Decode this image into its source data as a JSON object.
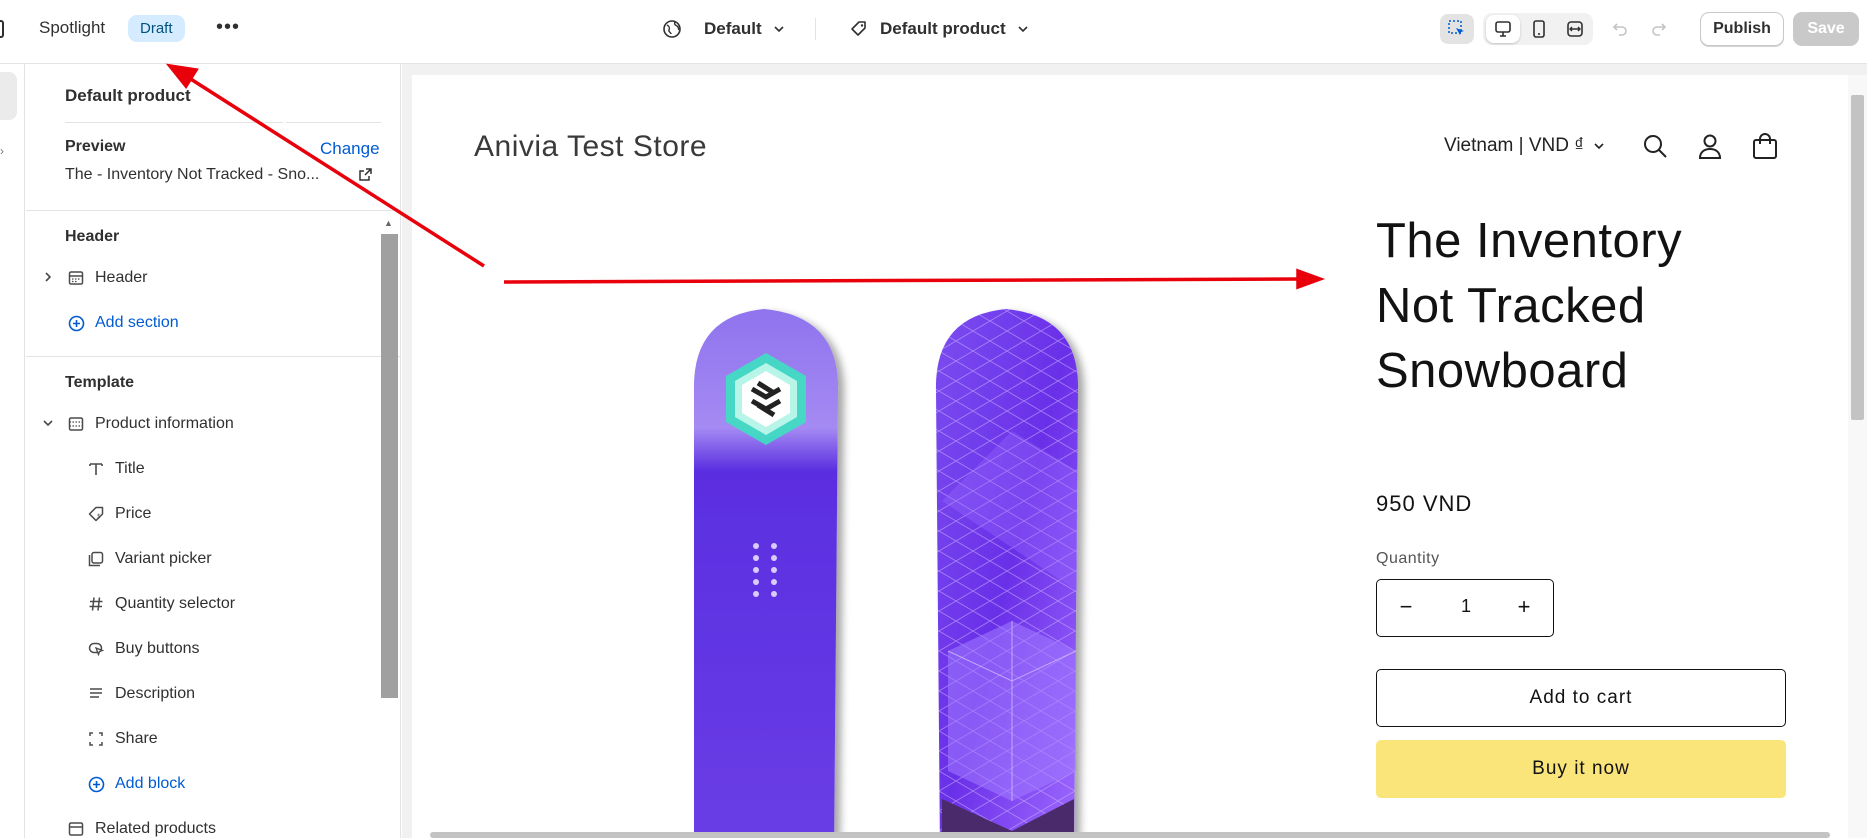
{
  "topbar": {
    "title": "Spotlight",
    "status_badge": "Draft",
    "more_icon": "more-horizontal-icon",
    "theme_selector": "Default",
    "template_selector": "Default product",
    "publish_label": "Publish",
    "save_label": "Save"
  },
  "sidebar": {
    "context_title": "Default product",
    "preview_label": "Preview",
    "change_label": "Change",
    "preview_value": "The - Inventory Not Tracked - Sno...",
    "header_group": "Header",
    "header_item": "Header",
    "add_section": "Add section",
    "template_group": "Template",
    "section": "Product information",
    "blocks": [
      {
        "label": "Title",
        "icon": "text-icon"
      },
      {
        "label": "Price",
        "icon": "price-tag-icon"
      },
      {
        "label": "Variant picker",
        "icon": "variant-icon"
      },
      {
        "label": "Quantity selector",
        "icon": "hash-icon"
      },
      {
        "label": "Buy buttons",
        "icon": "cursor-click-icon"
      },
      {
        "label": "Description",
        "icon": "text-lines-icon"
      },
      {
        "label": "Share",
        "icon": "share-frame-icon"
      }
    ],
    "add_block": "Add block",
    "related": "Related products"
  },
  "preview": {
    "store_name": "Anivia Test Store",
    "locale": "Vietnam | VND ₫",
    "product_title": "The Inventory Not Tracked Snowboard",
    "price": "950 VND",
    "quantity_label": "Quantity",
    "quantity_value": "1",
    "add_to_cart": "Add to cart",
    "buy_now": "Buy it now"
  },
  "colors": {
    "accent_link": "#005bd3",
    "badge_bg": "#d5ebff",
    "buy_now_bg": "#fae57a",
    "annotation_arrow": "#e8000b",
    "snowboard_purple": "#5a2ee0"
  }
}
